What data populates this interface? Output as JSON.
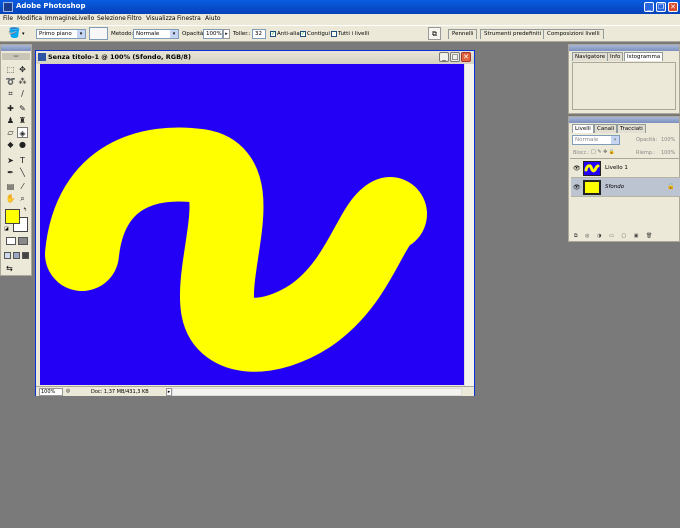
{
  "app": {
    "title": "Adobe Photoshop"
  },
  "menu": [
    "File",
    "Modifica",
    "Immagine",
    "Livello",
    "Selezione",
    "Filtro",
    "Visualizza",
    "Finestra",
    "Aiuto"
  ],
  "options": {
    "sample_value": "Primo piano",
    "method_label": "Metodo:",
    "method_value": "Normale",
    "opacity_label": "Opacità:",
    "opacity_value": "100%",
    "tolerance_label": "Toller.:",
    "tolerance_value": "32",
    "antialias_label": "Anti-alias",
    "contiguous_label": "Contigui",
    "all_layers_label": "Tutti i livelli"
  },
  "palette_tabs": [
    "Pennelli",
    "Strumenti predefiniti",
    "Composizioni livelli"
  ],
  "document": {
    "title": "Senza titolo-1 @ 100% (Sfondo, RGB/8)",
    "zoom": "100%",
    "doc_info": "Doc: 1,37 MB/431,3 KB"
  },
  "navigator_tabs": [
    "Navigatore",
    "Info",
    "Istogramma"
  ],
  "layers_panel": {
    "tabs": [
      "Livelli",
      "Canali",
      "Tracciati"
    ],
    "blend_mode": "Normale",
    "opacity_label": "Opacità:",
    "opacity_value": "100%",
    "lock_label": "Blocc.:",
    "fill_label": "Riemp.:",
    "fill_value": "100%",
    "layers": [
      {
        "name": "Livello 1",
        "selected": false
      },
      {
        "name": "Sfondo",
        "selected": true
      }
    ]
  },
  "colors": {
    "canvas_bg": "#2300f5",
    "stroke": "#ffff00",
    "foreground": "#ffff00",
    "background": "#ffffff"
  }
}
